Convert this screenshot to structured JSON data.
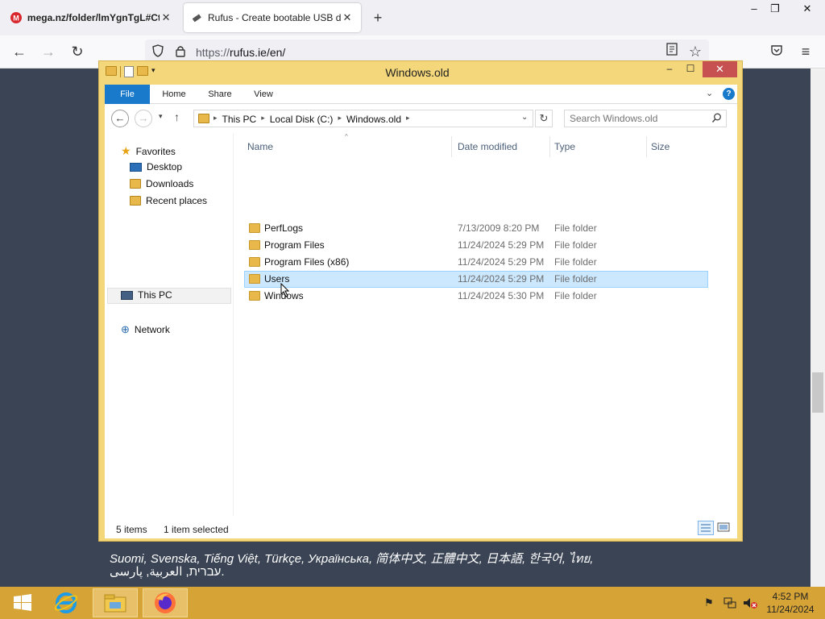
{
  "browser": {
    "tabs": [
      {
        "title": "mega.nz/folder/lmYgnTgL#Ct",
        "favicon_letter": "M"
      },
      {
        "title": "Rufus - Create bootable USB dr"
      }
    ],
    "url_scheme": "https://",
    "url_rest": "rufus.ie/en/"
  },
  "page": {
    "line1": "Suomi, Svenska, Tiếng Việt, Türkçe, Українська, 简体中文, 正體中文, 日本語, 한국어, ไทย,",
    "line2": "עברית, العربية, پارسی."
  },
  "explorer": {
    "title": "Windows.old",
    "ribbon_tabs": [
      "File",
      "Home",
      "Share",
      "View"
    ],
    "breadcrumb": [
      "This PC",
      "Local Disk (C:)",
      "Windows.old"
    ],
    "search_placeholder": "Search Windows.old",
    "nav": {
      "favorites": "Favorites",
      "desktop": "Desktop",
      "downloads": "Downloads",
      "recent": "Recent places",
      "this_pc": "This PC",
      "network": "Network"
    },
    "columns": [
      "Name",
      "Date modified",
      "Type",
      "Size"
    ],
    "files": [
      {
        "name": "PerfLogs",
        "date": "7/13/2009 8:20 PM",
        "type": "File folder",
        "selected": false
      },
      {
        "name": "Program Files",
        "date": "11/24/2024 5:29 PM",
        "type": "File folder",
        "selected": false
      },
      {
        "name": "Program Files (x86)",
        "date": "11/24/2024 5:29 PM",
        "type": "File folder",
        "selected": false
      },
      {
        "name": "Users",
        "date": "11/24/2024 5:29 PM",
        "type": "File folder",
        "selected": true
      },
      {
        "name": "Windows",
        "date": "11/24/2024 5:30 PM",
        "type": "File folder",
        "selected": false
      }
    ],
    "status": {
      "items": "5 items",
      "selected": "1 item selected"
    }
  },
  "taskbar": {
    "time": "4:52 PM",
    "date": "11/24/2024"
  },
  "colors": {
    "explorer_frame": "#f3d77a",
    "file_tab": "#1979ca",
    "close_button": "#c75050",
    "selection": "#cce8ff",
    "taskbar": "#d6a336",
    "page_background": "#3a4454"
  }
}
